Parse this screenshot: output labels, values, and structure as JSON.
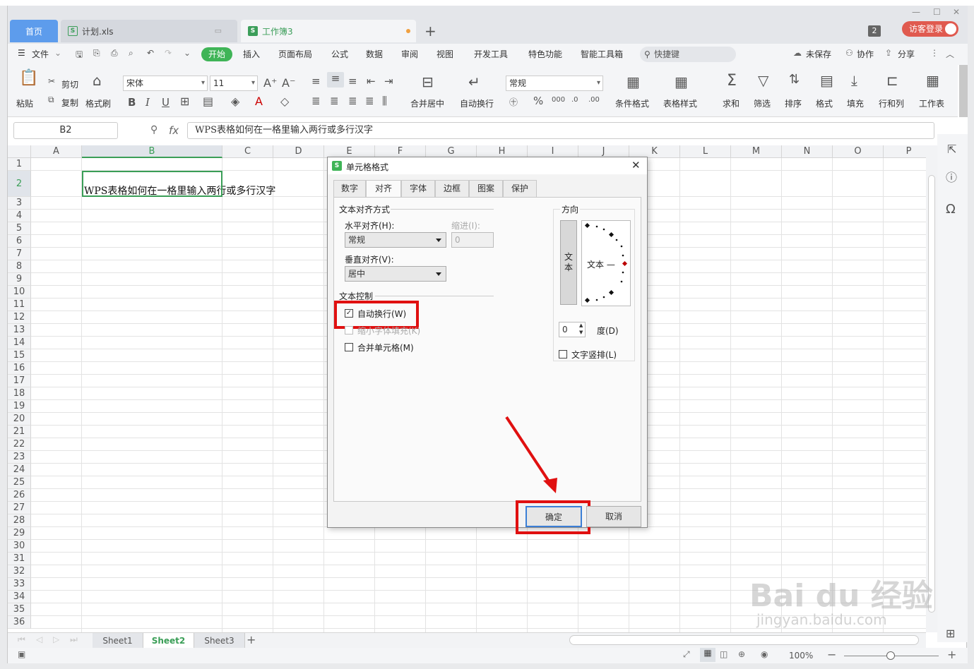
{
  "tabs": {
    "home": "首页",
    "doc1": "计划.xls",
    "doc2": "工作簿3",
    "doc_badge": "S",
    "count_badge": "2",
    "login": "访客登录"
  },
  "menu": {
    "file": "文件",
    "start": "开始",
    "insert": "插入",
    "page_layout": "页面布局",
    "formula": "公式",
    "data": "数据",
    "review": "审阅",
    "view": "视图",
    "dev_tools": "开发工具",
    "special": "特色功能",
    "smart_tools": "智能工具箱",
    "search": "快捷键",
    "unsaved": "未保存",
    "collab": "协作",
    "share": "分享"
  },
  "ribbon": {
    "paste": "粘贴",
    "cut": "剪切",
    "copy": "复制",
    "format_painter": "格式刷",
    "font_name": "宋体",
    "font_size": "11",
    "merge_center": "合并居中",
    "wrap_text": "自动换行",
    "number_format": "常规",
    "cond_format": "条件格式",
    "table_style": "表格样式",
    "sum": "求和",
    "filter": "筛选",
    "sort": "排序",
    "format": "格式",
    "fill": "填充",
    "row_col": "行和列",
    "worksheet": "工作表"
  },
  "formula_bar": {
    "name_box": "B2",
    "fx": "fx",
    "content": "WPS表格如何在一格里输入两行或多行汉字"
  },
  "grid": {
    "columns": [
      "A",
      "B",
      "C",
      "D",
      "E",
      "F",
      "G",
      "H",
      "I",
      "J",
      "K",
      "L",
      "M",
      "N",
      "O",
      "P"
    ],
    "selected_column": "B",
    "rows": [
      "1",
      "2",
      "3",
      "4",
      "5",
      "6",
      "7",
      "8",
      "9",
      "10",
      "11",
      "12",
      "13",
      "14",
      "15",
      "16",
      "17",
      "18",
      "19",
      "20",
      "21",
      "22",
      "23",
      "24",
      "25",
      "26",
      "27",
      "28",
      "29",
      "30",
      "31",
      "32",
      "33",
      "34",
      "35",
      "36"
    ],
    "selected_row": "2",
    "cell_B2": "WPS表格如何在一格里输入两行或多行汉字"
  },
  "sheets": [
    "Sheet1",
    "Sheet2",
    "Sheet3"
  ],
  "active_sheet": "Sheet2",
  "status": {
    "zoom": "100%"
  },
  "dialog": {
    "title": "单元格格式",
    "tabs": [
      "数字",
      "对齐",
      "字体",
      "边框",
      "图案",
      "保护"
    ],
    "active_tab": "对齐",
    "text_align_group": "文本对齐方式",
    "h_align_label": "水平对齐(H):",
    "h_align_value": "常规",
    "indent_label": "缩进(I):",
    "indent_value": "0",
    "v_align_label": "垂直对齐(V):",
    "v_align_value": "居中",
    "text_control_group": "文本控制",
    "wrap_text": "自动换行(W)",
    "shrink_to_fit": "缩小字体填充(K)",
    "merge_cells": "合并单元格(M)",
    "orientation_group": "方向",
    "vertical_text": "文本",
    "orientation_text": "文本 —",
    "degree_value": "0",
    "degree_label": "度(D)",
    "text_vertical": "文字竖排(L)",
    "ok": "确定",
    "cancel": "取消"
  },
  "watermark": {
    "logo": "Bai du 经验",
    "url": "jingyan.baidu.com"
  }
}
